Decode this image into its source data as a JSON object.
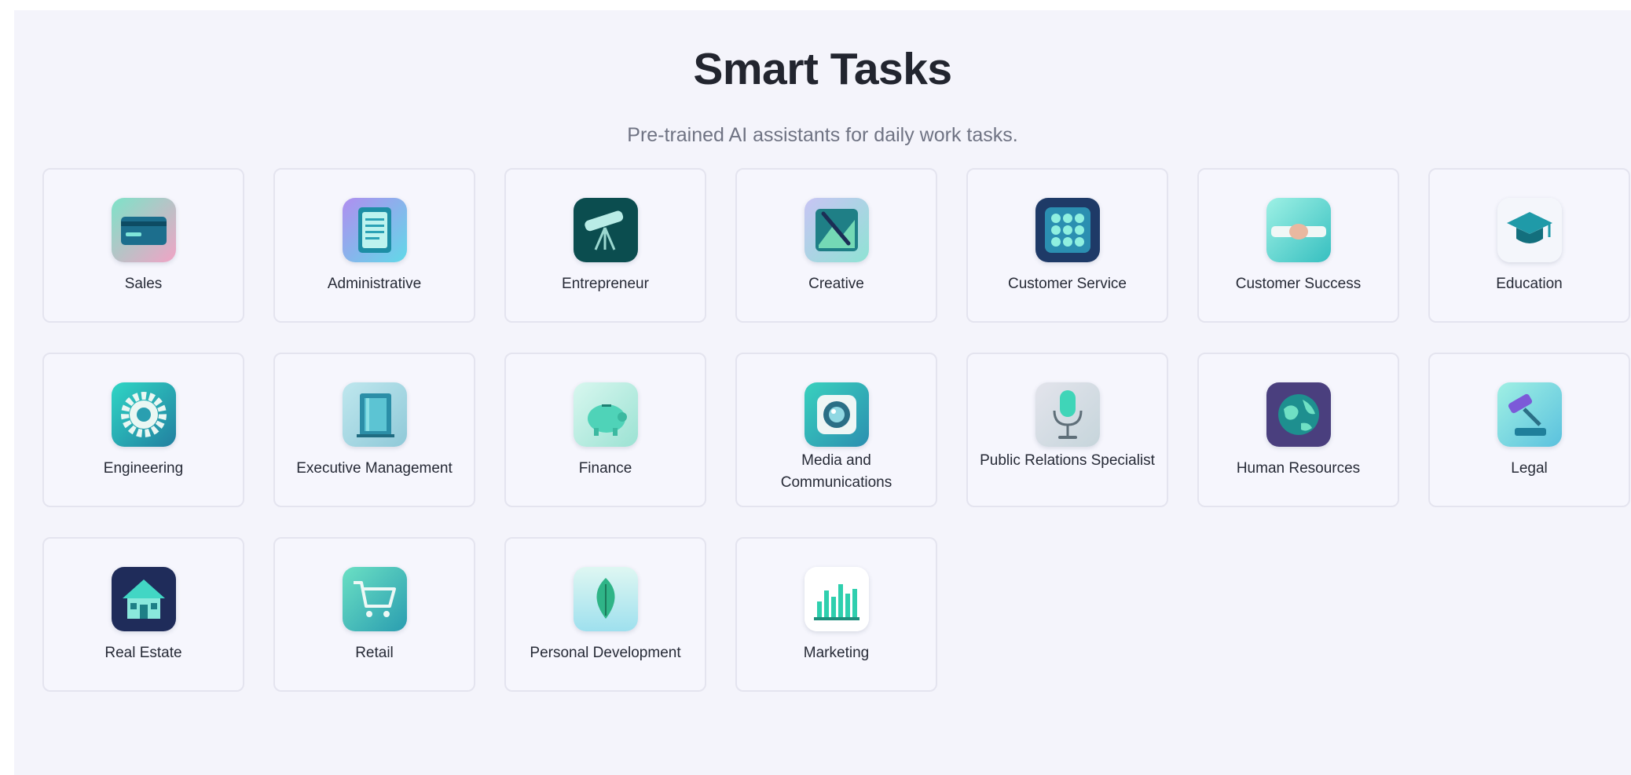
{
  "header": {
    "title": "Smart Tasks",
    "subtitle": "Pre-trained AI assistants for daily work tasks."
  },
  "categories": [
    {
      "label": "Sales",
      "icon": "credit-card-icon"
    },
    {
      "label": "Administrative",
      "icon": "clipboard-icon"
    },
    {
      "label": "Entrepreneur",
      "icon": "telescope-icon"
    },
    {
      "label": "Creative",
      "icon": "paintbrush-icon"
    },
    {
      "label": "Customer Service",
      "icon": "dial-pad-icon"
    },
    {
      "label": "Customer Success",
      "icon": "handshake-icon"
    },
    {
      "label": "Education",
      "icon": "graduation-cap-icon"
    },
    {
      "label": "Engineering",
      "icon": "gear-icon"
    },
    {
      "label": "Executive Management",
      "icon": "office-building-icon"
    },
    {
      "label": "Finance",
      "icon": "piggy-bank-icon"
    },
    {
      "label": "Media and Communications",
      "icon": "camera-lens-icon"
    },
    {
      "label": "Public Relations Specialist",
      "icon": "microphone-icon"
    },
    {
      "label": "Human Resources",
      "icon": "globe-icon"
    },
    {
      "label": "Legal",
      "icon": "gavel-icon"
    },
    {
      "label": "Real Estate",
      "icon": "house-icon"
    },
    {
      "label": "Retail",
      "icon": "shopping-cart-icon"
    },
    {
      "label": "Personal Development",
      "icon": "leaf-icon"
    },
    {
      "label": "Marketing",
      "icon": "bar-chart-icon"
    }
  ]
}
